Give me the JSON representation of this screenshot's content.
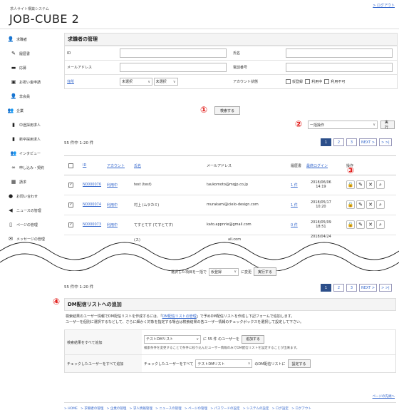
{
  "header": {
    "logout": "> ログアウト",
    "subtitle": "求人サイト構築システム",
    "brand": "JOB-CUBE 2"
  },
  "sidebar": {
    "items": [
      {
        "label": "求職者",
        "icon": "user-icon"
      },
      {
        "label": "履歴書",
        "icon": "pencil-icon"
      },
      {
        "label": "応募",
        "icon": "inbox-icon"
      },
      {
        "label": "お祝い金申請",
        "icon": "gift-icon"
      },
      {
        "label": "非会員",
        "icon": "user-icon"
      },
      {
        "label": "企業",
        "icon": "users-icon"
      },
      {
        "label": "中途採用求人",
        "icon": "file-icon"
      },
      {
        "label": "新卒採用求人",
        "icon": "file-icon"
      },
      {
        "label": "インタビュー",
        "icon": "users-icon"
      },
      {
        "label": "申し込み・契約",
        "icon": "link-icon"
      },
      {
        "label": "請求",
        "icon": "calculator-icon"
      },
      {
        "label": "お問い合わせ",
        "icon": "info-icon"
      },
      {
        "label": "ニュースの管理",
        "icon": "megaphone-icon"
      },
      {
        "label": "ページの管理",
        "icon": "page-icon"
      },
      {
        "label": "メッセージの管理",
        "icon": "mail-icon"
      }
    ]
  },
  "search": {
    "title": "求職者の管理",
    "id_label": "ID",
    "name_label": "氏名",
    "email_label": "メールアドレス",
    "phone_label": "電話番号",
    "residence_label": "住所",
    "pref_value": "未選択",
    "city_value": "未選択",
    "account_status_label": "アカウント状態",
    "status_options": [
      "仮登録",
      "利用中",
      "利用不可"
    ],
    "search_button": "検索する"
  },
  "markers": [
    "①",
    "②",
    "③",
    "④"
  ],
  "bulk": {
    "select_value": "一括操作",
    "exec_button": "実行"
  },
  "results": {
    "count_text": "55 件中 1-20 件",
    "pagination": [
      "1",
      "2",
      "3",
      "NEXT >",
      "> >|"
    ],
    "columns": [
      "ID",
      "アカウント",
      "氏名",
      "メールアドレス",
      "履歴書",
      "最終ログイン",
      "操作"
    ],
    "rows": [
      {
        "id": "N0000076",
        "account": "利用中",
        "name": "test (test)",
        "email": "taukomoto@mqjp.co.jp",
        "resume": "1 件",
        "login_date": "2018/06/06",
        "login_time": "14:19",
        "checked": true
      },
      {
        "id": "N0000074",
        "account": "利用中",
        "name": "村上 (ムラカミ)",
        "email": "murakami@cielo-design.com",
        "resume": "1 件",
        "login_date": "2018/05/17",
        "login_time": "10:20",
        "checked": true
      },
      {
        "id": "N0000073",
        "account": "利用中",
        "name": "てすとてす (てすとてす)",
        "email": "kato.appnrie@gmail.com",
        "resume": "0 件",
        "login_date": "2018/05/09",
        "login_time": "18:51",
        "checked": true
      },
      {
        "id": "",
        "account": "",
        "name": "(ス)",
        "email": "ail.com",
        "resume": "",
        "login_date": "2018/04/24",
        "login_time": "",
        "checked": false
      }
    ],
    "bottom_prefix": "選択した項目を一括で",
    "bottom_select": "仮登録",
    "bottom_suffix": "に変更",
    "bottom_button": "実行する"
  },
  "dm": {
    "title": "DM配信リストへの追加",
    "desc_1a": "検索結果のユーザー情報でDM配信リストを作成するには、「",
    "desc_1_link": "DM配信リストの管理",
    "desc_1b": "」で予めDM配信リストを作成し下記フォームで追加します。",
    "desc_2": "ユーザーを個別に選択するなどして、さらに細かく対象を指定する場合は検索結果の各ユーザー情報のチェックボックスを選択して設定して下さい。",
    "row1_label": "検索結果をすべて追加",
    "row1_select": "テストDMリスト",
    "row1_mid": "に 55 件 のユーザーを",
    "row1_button": "追加する",
    "row1_note": "検索条件を変更することで条件に絞り込んだユーザー情報のみでDM配信リストを設定することが出来ます。",
    "row2_label": "チェックしたユーザーをすべて追加",
    "row2_prefix": "チェックしたユーザーをすべて",
    "row2_select": "テストDMリスト",
    "row2_mid": "のDM配信リストに",
    "row2_button": "設定する"
  },
  "footer": {
    "page_top": "ページの先頭へ",
    "links": [
      "> HOME",
      "> 求職者の管理",
      "> 企業の管理",
      "> 求人情報管理",
      "> ニュースの管理",
      "> ページの管理",
      "> パスワードの設定",
      "> システムの設定",
      "> ログ設定",
      "> ログアウト"
    ]
  }
}
